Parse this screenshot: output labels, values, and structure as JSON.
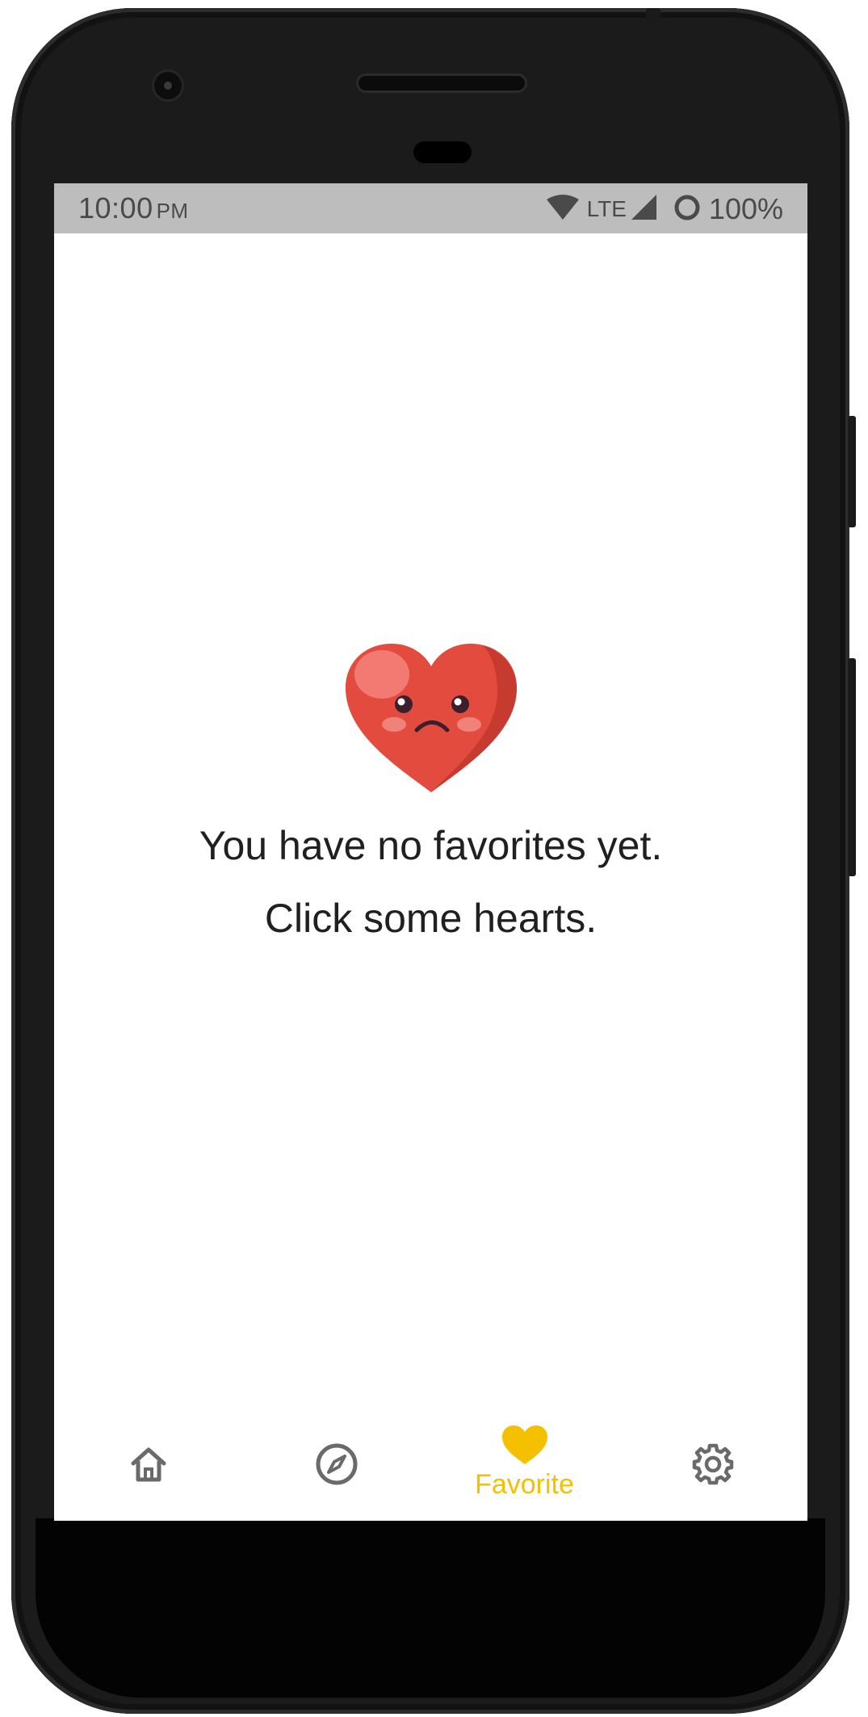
{
  "status_bar": {
    "time": "10:00",
    "ampm": "PM",
    "network": "LTE",
    "battery": "100%"
  },
  "empty_state": {
    "line1": "You have no favorites yet.",
    "line2": "Click some hearts."
  },
  "bottom_nav": {
    "items": [
      {
        "icon": "home-icon",
        "label": ""
      },
      {
        "icon": "compass-icon",
        "label": ""
      },
      {
        "icon": "heart-icon",
        "label": "Favorite",
        "active": true
      },
      {
        "icon": "gear-icon",
        "label": ""
      }
    ]
  },
  "colors": {
    "accent": "#f5c000",
    "heart": "#e34b3f",
    "status_bar_bg": "#bdbdbd",
    "icon_inactive": "#6a6a6a"
  }
}
